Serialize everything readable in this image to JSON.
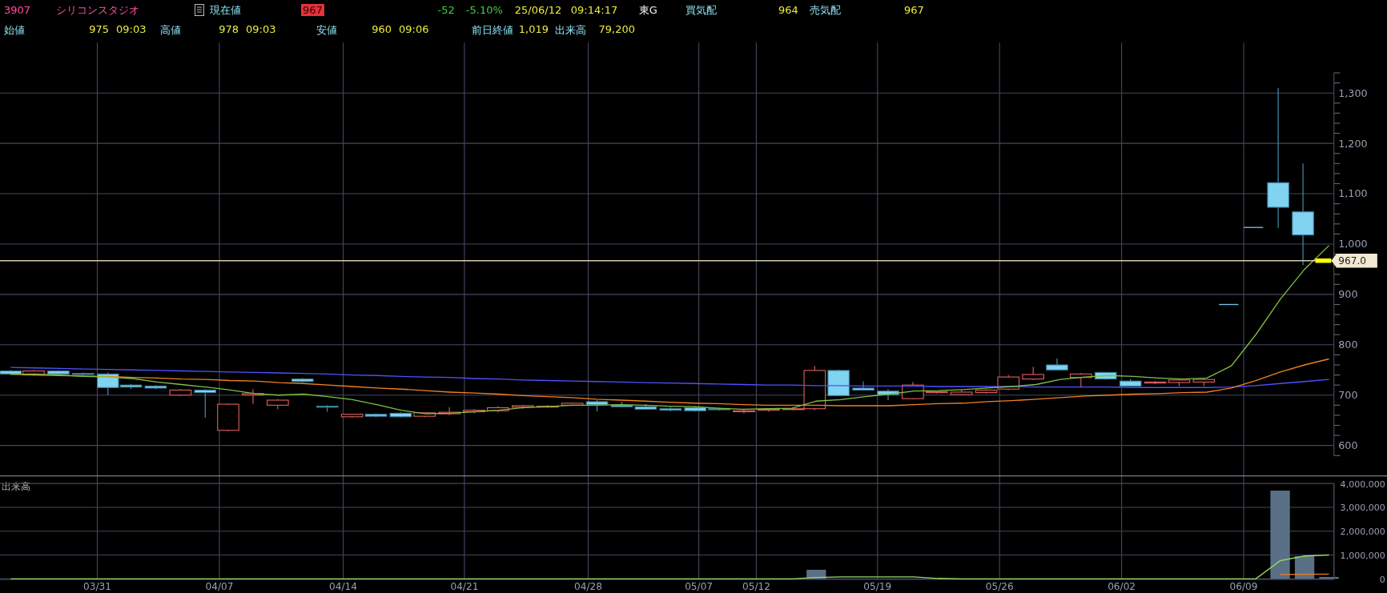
{
  "quote": {
    "code": "3907",
    "name": "シリコンスタジオ",
    "price_label": "現在値",
    "price": "967",
    "change": "-52",
    "change_pct": "-5.10%",
    "date": "25/06/12",
    "time": "09:14:17",
    "market": "東G",
    "bid_label": "買気配",
    "bid": "964",
    "ask_label": "売気配",
    "ask": "967"
  },
  "stats": [
    {
      "label": "始値",
      "value": "975",
      "time": "09:03"
    },
    {
      "label": "高値",
      "value": "978",
      "time": "09:03"
    },
    {
      "label": "安値",
      "value": "960",
      "time": "09:06"
    },
    {
      "label": "前日終値",
      "value": "1,019"
    },
    {
      "label": "出来高",
      "value": "79,200"
    }
  ],
  "price_chart": {
    "current_price": "967.0",
    "chart_data": {
      "type": "line",
      "grid": true,
      "series": [
        {
          "color": "#5050ff",
          "values": [
            755,
            754,
            753,
            752,
            751,
            750,
            749,
            748,
            747,
            746,
            745,
            744,
            743,
            742,
            740,
            739,
            737,
            736,
            735,
            733,
            732,
            730,
            729,
            728,
            727,
            726,
            725,
            724,
            723,
            722,
            721,
            720,
            720,
            719,
            719,
            718,
            718,
            718,
            717,
            717,
            717,
            717,
            716,
            716,
            716,
            716,
            715,
            715,
            715,
            715,
            716,
            719,
            723,
            727,
            731
          ]
        },
        {
          "color": "#f08020",
          "values": [
            742,
            740,
            739,
            738,
            737,
            735,
            734,
            732,
            731,
            729,
            728,
            725,
            723,
            720,
            717,
            714,
            712,
            709,
            706,
            704,
            702,
            699,
            697,
            695,
            692,
            690,
            688,
            686,
            684,
            683,
            681,
            680,
            680,
            680,
            679,
            679,
            679,
            681,
            683,
            684,
            687,
            689,
            692,
            695,
            698,
            700,
            702,
            703,
            705,
            706,
            714,
            729,
            746,
            760,
            772
          ]
        },
        {
          "color": "#80c040",
          "values": [
            741,
            742,
            740,
            737,
            736,
            733,
            726,
            721,
            716,
            710,
            703,
            700,
            702,
            697,
            691,
            681,
            670,
            663,
            664,
            667,
            670,
            675,
            677,
            680,
            680,
            681,
            680,
            678,
            677,
            674,
            672,
            673,
            674,
            688,
            691,
            697,
            702,
            708,
            709,
            711,
            714,
            717,
            721,
            731,
            736,
            739,
            737,
            734,
            732,
            734,
            758,
            820,
            890,
            950,
            997
          ]
        }
      ],
      "ylim": [
        580,
        1340
      ],
      "yticks": [
        {
          "value": 1300,
          "label": "1,300"
        },
        {
          "value": 1200,
          "label": "1,200"
        },
        {
          "value": 1100,
          "label": "1,100"
        },
        {
          "value": 1000,
          "label": "1,000"
        },
        {
          "value": 900,
          "label": "900"
        },
        {
          "value": 800,
          "label": "800"
        },
        {
          "value": 700,
          "label": "700"
        },
        {
          "value": 600,
          "label": "600"
        }
      ]
    },
    "date_labels": [
      "03/31",
      "04/07",
      "04/14",
      "04/21",
      "04/28",
      "05/07",
      "05/12",
      "05/19",
      "05/26",
      "06/02",
      "06/09"
    ]
  },
  "volume_chart": {
    "title": "出来高",
    "chart_data": {
      "type": "bar",
      "grid": true,
      "ylim": [
        0,
        4000000
      ],
      "series": [
        {
          "color": "#5a7086",
          "values": [
            null,
            null,
            null,
            null,
            null,
            null,
            null,
            null,
            null,
            null,
            null,
            null,
            null,
            null,
            null,
            null,
            null,
            null,
            null,
            null,
            null,
            null,
            null,
            null,
            null,
            null,
            null,
            null,
            null,
            null,
            null,
            null,
            null,
            380000,
            null,
            null,
            null,
            null,
            null,
            null,
            null,
            null,
            null,
            null,
            null,
            null,
            null,
            null,
            null,
            null,
            null,
            null,
            3700000,
            950000,
            80000
          ]
        }
      ],
      "yticks": [
        {
          "value": 4000000,
          "label": "4,000,000"
        },
        {
          "value": 3000000,
          "label": "3,000,000"
        },
        {
          "value": 2000000,
          "label": "2,000,000"
        },
        {
          "value": 1000000,
          "label": "1,000,000"
        },
        {
          "value": 0,
          "label": "0"
        }
      ]
    }
  },
  "volume_average_chart": {
    "chart_data": {
      "type": "line",
      "ylim": [
        0,
        4000000
      ],
      "series": [
        {
          "color": "#f08020",
          "values": [
            null,
            null,
            null,
            null,
            null,
            null,
            null,
            null,
            null,
            null,
            null,
            null,
            null,
            null,
            null,
            null,
            null,
            null,
            null,
            null,
            null,
            null,
            null,
            null,
            null,
            null,
            null,
            null,
            null,
            null,
            null,
            null,
            null,
            null,
            null,
            null,
            null,
            null,
            null,
            null,
            null,
            null,
            null,
            null,
            null,
            null,
            null,
            null,
            null,
            null,
            null,
            null,
            180000,
            190000,
            200000
          ]
        },
        {
          "color": "#90e060",
          "values": [
            0,
            0,
            0,
            0,
            0,
            0,
            0,
            0,
            0,
            0,
            0,
            0,
            0,
            0,
            0,
            0,
            0,
            0,
            0,
            0,
            0,
            0,
            0,
            0,
            0,
            0,
            0,
            0,
            0,
            0,
            0,
            0,
            0,
            60000,
            80000,
            80000,
            80000,
            80000,
            20000,
            0,
            0,
            0,
            0,
            0,
            0,
            0,
            0,
            0,
            0,
            0,
            0,
            0,
            760000,
            960000,
            1000000
          ]
        }
      ]
    }
  }
}
